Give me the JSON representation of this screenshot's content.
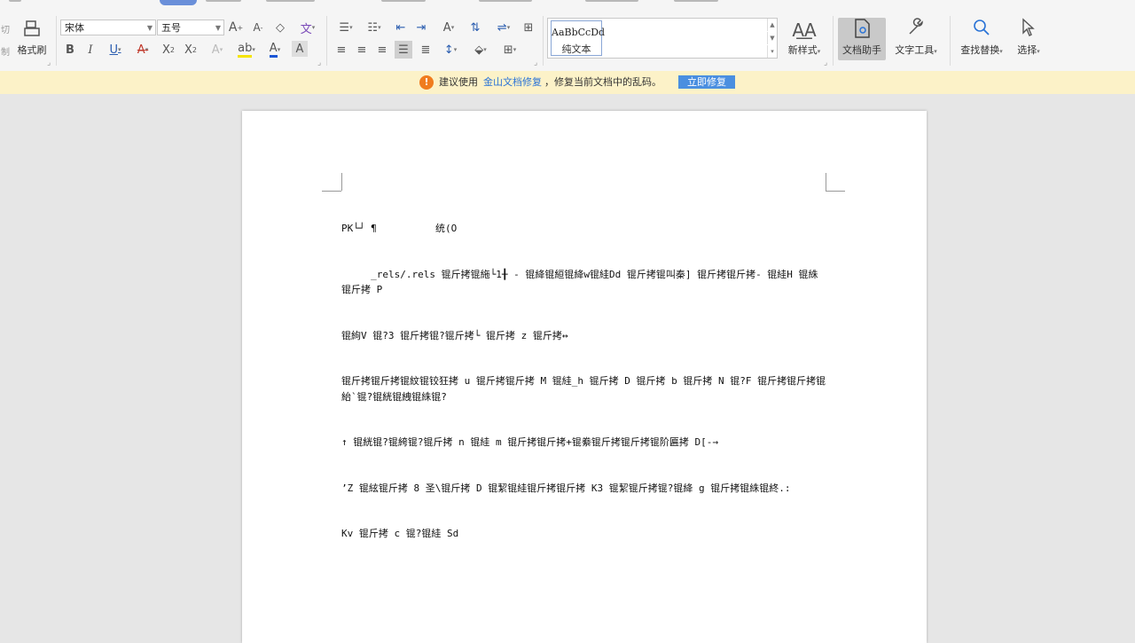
{
  "toolbar": {
    "format_painter_label": "格式刷",
    "font_name": "宋体",
    "font_size": "五号",
    "style_preview": "AaBbCcDd",
    "style_name": "纯文本",
    "new_style_label": "新样式",
    "doc_assistant_label": "文档助手",
    "text_tools_label": "文字工具",
    "find_replace_label": "查找替换",
    "select_label": "选择",
    "left_cut_label": "切",
    "left_copy_label": "制"
  },
  "notification": {
    "text_before": "建议使用",
    "link": "金山文档修复",
    "text_after": "，修复当前文档中的乱码。",
    "button": "立即修复"
  },
  "document": {
    "lines": [
      "PK└┘ ¶          统(O",
      "     _rels/.rels 锟斤拷锟絁└1╂ - 锟絳锟絙锟絳w锟絓Dd 锟斤拷锟叫秦] 锟斤拷锟斤拷- 锟絓H 锟絑锟斤拷 P",
      "锟絇V 锟?3 锟斤拷锟?锟斤拷└ 锟斤拷 z 锟斤拷↔",
      "锟斤拷锟斤拷锟紋锟铰狂拷 u 锟斤拷锟斤拷 M 锟絓_h 锟斤拷 D 锟斤拷 b 锟斤拷 N 锟?F 锟斤拷锟斤拷锟紿`锟?锟絖锟絏锟絑锟?",
      "↑ 锟絖锟?锟絝锟?锟斤拷 n 锟絓 m 锟斤拷锟斤拷+锟絭锟斤拷锟斤拷锟阶匾拷 D[-→",
      "’Z 锟絃锟斤拷 8 圣\\锟斤拷 D 锟絜锟絓锟斤拷锟斤拷 K3 锟絜锟斤拷锟?锟絳 g 锟斤拷锟絑锟終.:",
      "Kv 锟斤拷 c 锟?锟絓 Sd"
    ]
  },
  "colors": {
    "notification_bg": "#fcf2c8",
    "link": "#2a73d6",
    "repair_button": "#4a8fe0",
    "warning_icon": "#f07c1e"
  }
}
